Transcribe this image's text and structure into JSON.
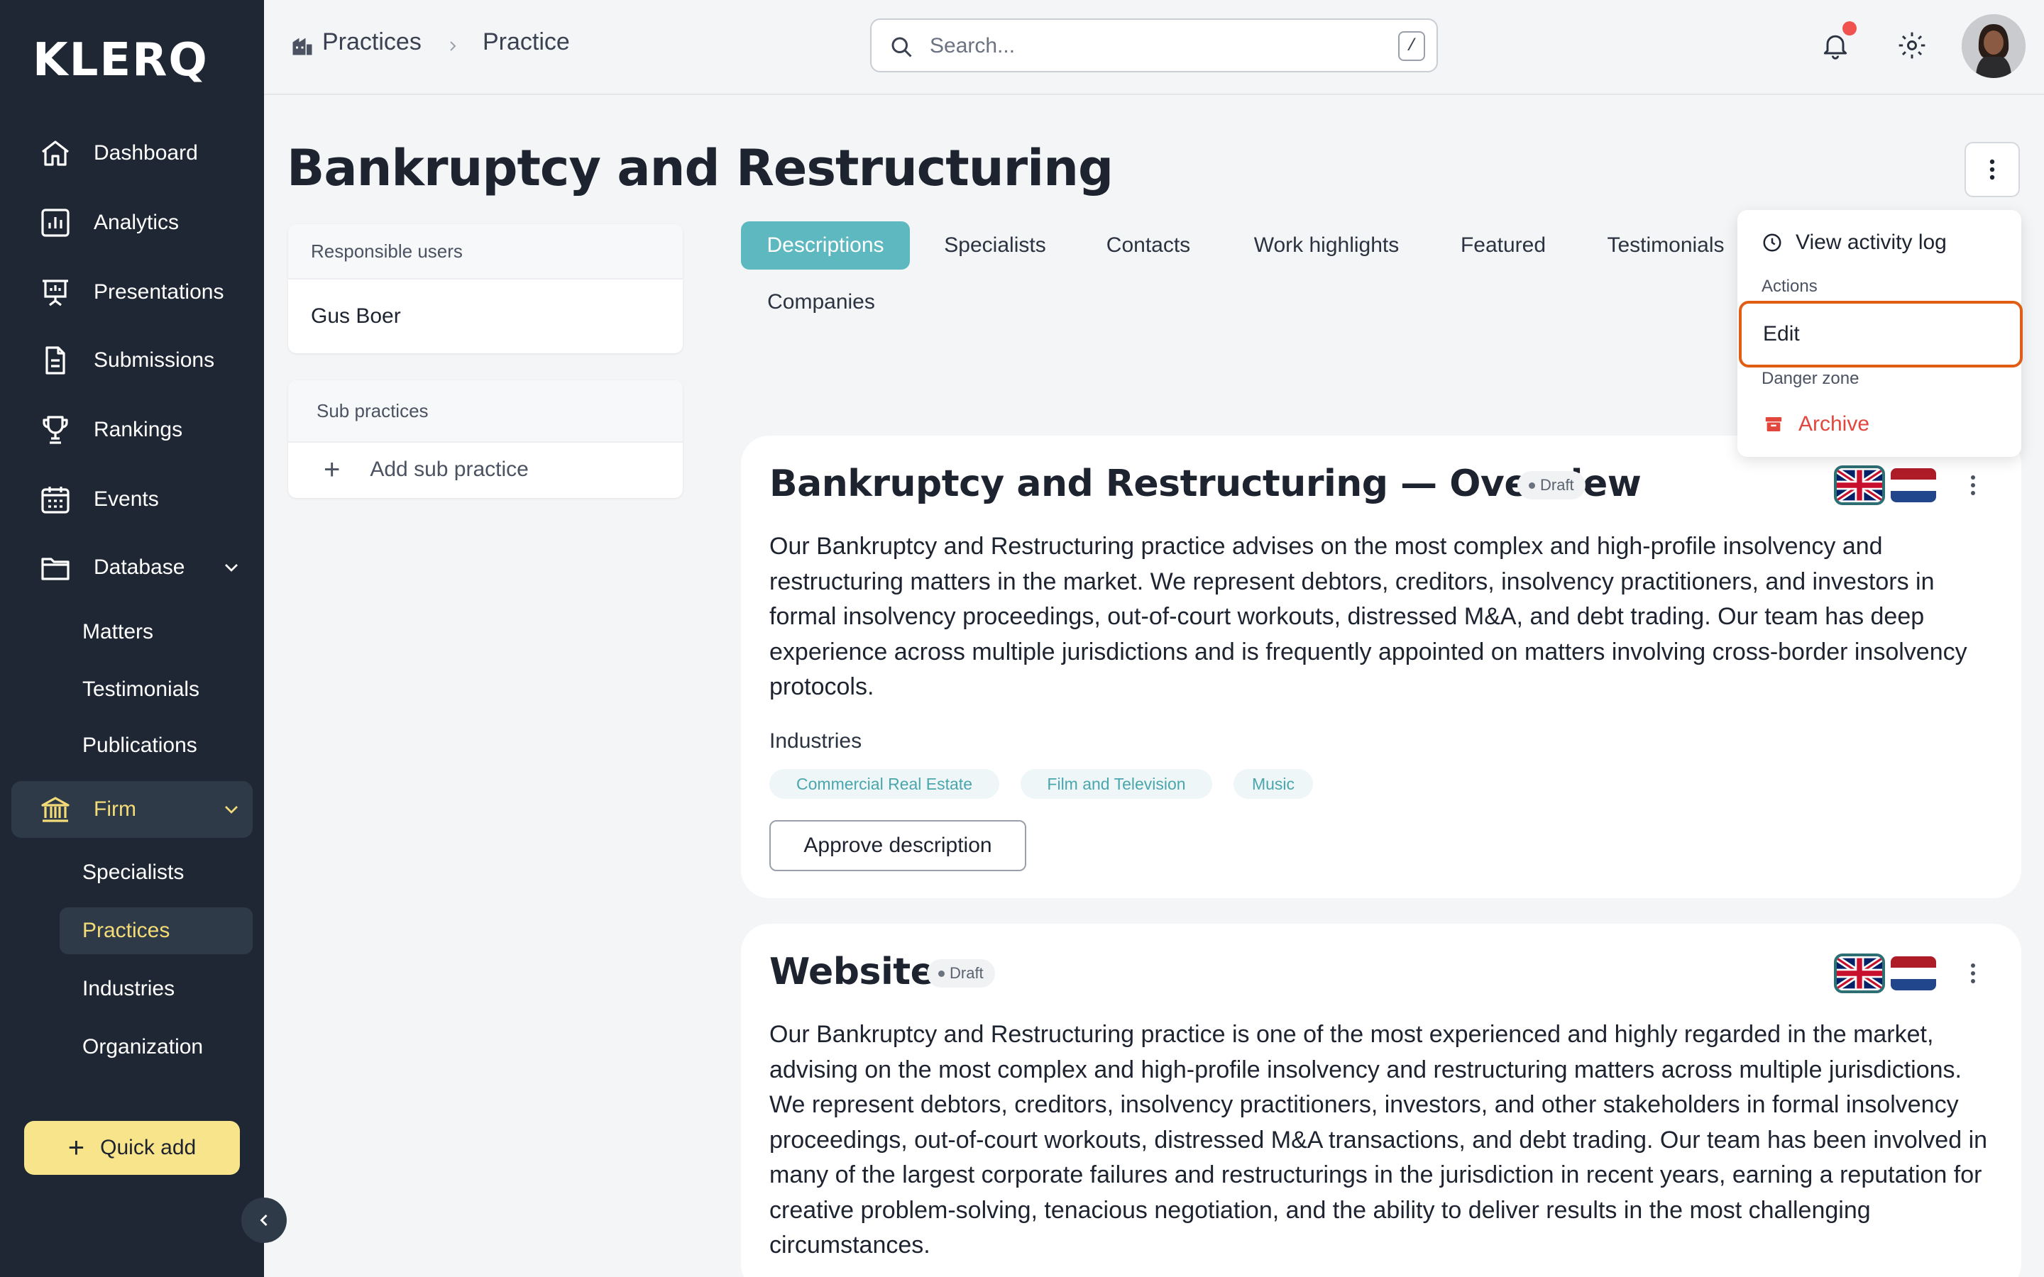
{
  "brand": {
    "logo_text": "KLERQ",
    "accent": "#5eb8bf",
    "sidebar_bg": "#1f2734",
    "highlight": "#f3dc77"
  },
  "sidebar": {
    "items": [
      {
        "label": "Dashboard",
        "icon": "home-icon"
      },
      {
        "label": "Analytics",
        "icon": "chart-icon"
      },
      {
        "label": "Presentations",
        "icon": "presentation-icon"
      },
      {
        "label": "Submissions",
        "icon": "document-icon"
      },
      {
        "label": "Rankings",
        "icon": "trophy-icon"
      },
      {
        "label": "Events",
        "icon": "calendar-icon"
      },
      {
        "label": "Database",
        "icon": "folder-icon"
      }
    ],
    "database_sub": [
      "Matters",
      "Testimonials",
      "Publications"
    ],
    "firm": {
      "label": "Firm",
      "icon": "bank-icon"
    },
    "firm_sub": [
      "Specialists",
      "Practices",
      "Industries",
      "Organization"
    ],
    "quick_add": "Quick add"
  },
  "topbar": {
    "breadcrumb": [
      "Practices",
      "Practice"
    ],
    "search_placeholder": "Search...",
    "search_shortcut": "/"
  },
  "page": {
    "title": "Bankruptcy and Restructuring",
    "responsible_users": {
      "header": "Responsible users",
      "users": [
        "Gus Boer"
      ]
    },
    "sub_practices": {
      "header": "Sub practices",
      "add_label": "Add sub practice"
    },
    "tabs": [
      "Descriptions",
      "Specialists",
      "Contacts",
      "Work highlights",
      "Featured",
      "Testimonials",
      "Companies"
    ],
    "active_tab": "Descriptions"
  },
  "menu": {
    "view_log": "View activity log",
    "actions_header": "Actions",
    "edit": "Edit",
    "danger_header": "Danger zone",
    "archive": "Archive"
  },
  "descriptions": [
    {
      "title": "Bankruptcy and Restructuring — Overview",
      "status": "Draft",
      "text": "Our Bankruptcy and Restructuring practice advises on the most complex and high-profile insolvency and restructuring matters in the market. We represent debtors, creditors, insolvency practitioners, and investors in formal insolvency proceedings, out-of-court workouts, distressed M&A, and debt trading. Our team has deep experience across multiple jurisdictions and is frequently appointed on matters involving cross-border insolvency protocols.",
      "industries_label": "Industries",
      "industries": [
        "Commercial Real Estate",
        "Film and Television",
        "Music"
      ],
      "approve_label": "Approve description"
    },
    {
      "title": "Website",
      "status": "Draft",
      "text": "Our Bankruptcy and Restructuring practice is one of the most experienced and highly regarded in the market, advising on the most complex and high-profile insolvency and restructuring matters across multiple jurisdictions. We represent debtors, creditors, insolvency practitioners, investors, and other stakeholders in formal insolvency proceedings, out-of-court workouts, distressed M&A transactions, and debt trading. Our team has been involved in many of the largest corporate failures and restructurings in the jurisdiction in recent years, earning a reputation for creative problem-solving, tenacious negotiation, and the ability to deliver results in the most challenging circumstances."
    }
  ]
}
